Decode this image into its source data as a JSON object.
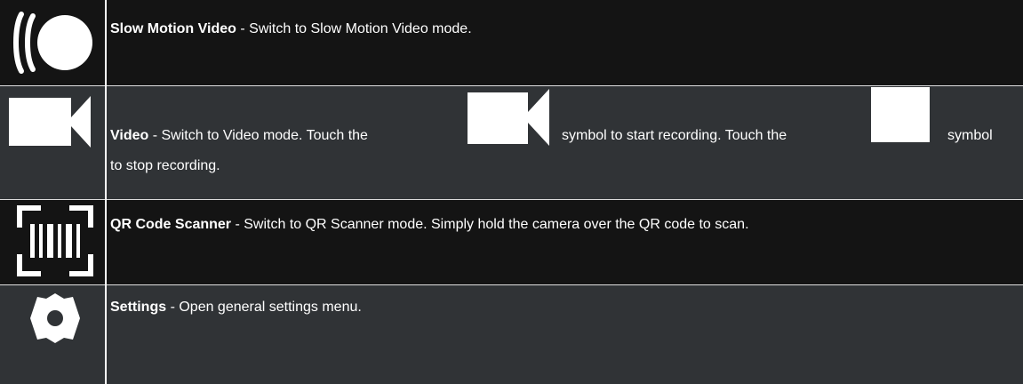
{
  "rows": [
    {
      "icon": "slow-motion-video-icon",
      "title": "Slow Motion Video",
      "description": " - Switch to Slow Motion Video mode."
    },
    {
      "icon": "video-camera-icon",
      "title": "Video",
      "description_part1": " - Switch to Video mode.  Touch the",
      "description_part2": "symbol to start recording.  Touch the",
      "description_part3": "symbol",
      "description_part4": "to stop recording.",
      "inline_icons": [
        "video-camera-icon",
        "stop-square-icon"
      ]
    },
    {
      "icon": "qr-scanner-icon",
      "title": "QR Code Scanner",
      "description": " - Switch to QR Scanner mode.  Simply hold the camera over the QR code to scan."
    },
    {
      "icon": "gear-icon",
      "title": "Settings",
      "description": " - Open general settings menu."
    }
  ],
  "colors": {
    "dark_row": "#141414",
    "light_row": "#303336",
    "text": "#ffffff"
  }
}
